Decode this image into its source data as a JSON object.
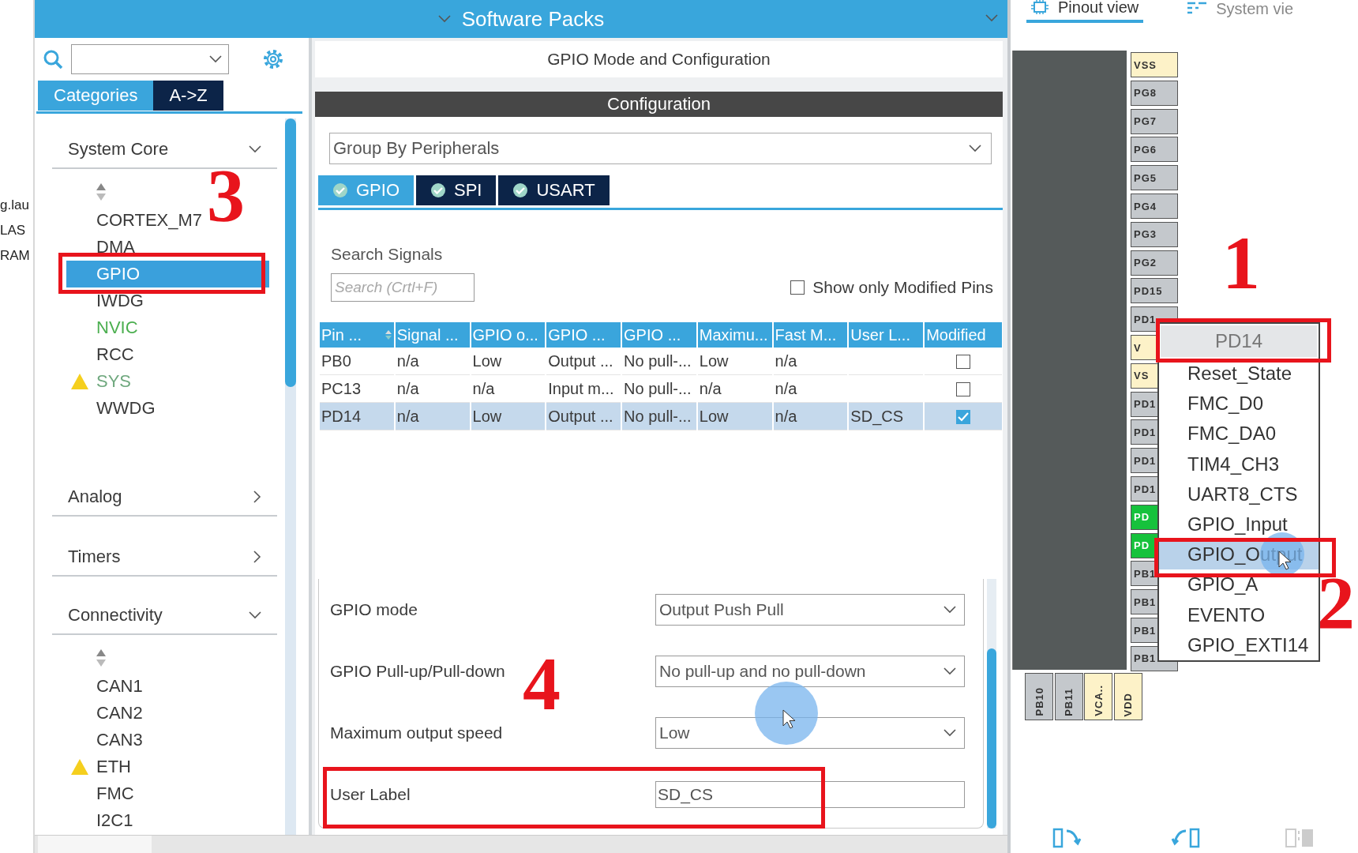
{
  "left_edge": {
    "texts": [
      "g.lau",
      "LAS",
      "RAM"
    ]
  },
  "header": {
    "title": "Software Packs"
  },
  "sidebar": {
    "tabs": [
      {
        "label": "Categories",
        "selected": true
      },
      {
        "label": "A->Z",
        "selected": false
      }
    ],
    "groups": [
      {
        "label": "System Core",
        "expanded": true,
        "items": [
          {
            "label": "CORTEX_M7",
            "selected": false,
            "warning": false,
            "color": "#3a3a3a"
          },
          {
            "label": "DMA",
            "selected": false,
            "warning": false,
            "color": "#3a3a3a"
          },
          {
            "label": "GPIO",
            "selected": true,
            "warning": false,
            "color": "#ffffff"
          },
          {
            "label": "IWDG",
            "selected": false,
            "warning": false,
            "color": "#3a3a3a"
          },
          {
            "label": "NVIC",
            "selected": false,
            "warning": false,
            "color": "#4caf50"
          },
          {
            "label": "RCC",
            "selected": false,
            "warning": false,
            "color": "#3a3a3a"
          },
          {
            "label": "SYS",
            "selected": false,
            "warning": true,
            "color": "#6fa87e"
          },
          {
            "label": "WWDG",
            "selected": false,
            "warning": false,
            "color": "#3a3a3a"
          }
        ]
      },
      {
        "label": "Analog",
        "expanded": false
      },
      {
        "label": "Timers",
        "expanded": false
      },
      {
        "label": "Connectivity",
        "expanded": true,
        "items": [
          {
            "label": "CAN1",
            "selected": false,
            "warning": false,
            "color": "#3a3a3a"
          },
          {
            "label": "CAN2",
            "selected": false,
            "warning": false,
            "color": "#3a3a3a"
          },
          {
            "label": "CAN3",
            "selected": false,
            "warning": false,
            "color": "#3a3a3a"
          },
          {
            "label": "ETH",
            "selected": false,
            "warning": true,
            "color": "#3a3a3a"
          },
          {
            "label": "FMC",
            "selected": false,
            "warning": false,
            "color": "#3a3a3a"
          },
          {
            "label": "I2C1",
            "selected": false,
            "warning": false,
            "color": "#3a3a3a"
          }
        ]
      }
    ]
  },
  "mode_panel": {
    "title": "GPIO Mode and Configuration",
    "section": "Configuration",
    "group_select": "Group By Peripherals",
    "tabs": [
      {
        "label": "GPIO",
        "selected": true
      },
      {
        "label": "SPI",
        "selected": false
      },
      {
        "label": "USART",
        "selected": false
      }
    ],
    "search_label": "Search Signals",
    "search": {
      "placeholder": "Search (Crtl+F)"
    },
    "modified_only": {
      "label": "Show only Modified Pins",
      "checked": false
    },
    "table": {
      "columns": [
        "Pin ...",
        "Signal ...",
        "GPIO o...",
        "GPIO ...",
        "GPIO ...",
        "Maximu...",
        "Fast M...",
        "User L...",
        "Modified"
      ],
      "rows": [
        {
          "cells": [
            "PB0",
            "n/a",
            "Low",
            "Output ...",
            "No pull-...",
            "Low",
            "n/a",
            ""
          ],
          "modified": false,
          "selected": false
        },
        {
          "cells": [
            "PC13",
            "n/a",
            "n/a",
            "Input m...",
            "No pull-...",
            "n/a",
            "n/a",
            ""
          ],
          "modified": false,
          "selected": false
        },
        {
          "cells": [
            "PD14",
            "n/a",
            "Low",
            "Output ...",
            "No pull-...",
            "Low",
            "n/a",
            "SD_CS"
          ],
          "modified": true,
          "selected": true
        }
      ]
    },
    "settings": [
      {
        "label": "GPIO mode",
        "value": "Output Push Pull",
        "kind": "select"
      },
      {
        "label": "GPIO Pull-up/Pull-down",
        "value": "No pull-up and no pull-down",
        "kind": "select"
      },
      {
        "label": "Maximum output speed",
        "value": "Low",
        "kind": "select"
      },
      {
        "label": "User Label",
        "value": "SD_CS",
        "kind": "text"
      }
    ]
  },
  "pinout": {
    "tabs": [
      {
        "label": "Pinout view",
        "selected": true
      },
      {
        "label": "System vie",
        "selected": false
      }
    ],
    "right_pins": [
      {
        "label": "VSS",
        "kind": "power"
      },
      {
        "label": "PG8",
        "kind": "signal"
      },
      {
        "label": "PG7",
        "kind": "signal"
      },
      {
        "label": "PG6",
        "kind": "signal"
      },
      {
        "label": "PG5",
        "kind": "signal"
      },
      {
        "label": "PG4",
        "kind": "signal"
      },
      {
        "label": "PG3",
        "kind": "signal"
      },
      {
        "label": "PG2",
        "kind": "signal"
      },
      {
        "label": "PD15",
        "kind": "signal"
      },
      {
        "label": "PD1",
        "kind": "signal"
      },
      {
        "label": "V",
        "kind": "power"
      },
      {
        "label": "VS",
        "kind": "power"
      },
      {
        "label": "PD1",
        "kind": "signal"
      },
      {
        "label": "PD1",
        "kind": "signal"
      },
      {
        "label": "PD1",
        "kind": "signal"
      },
      {
        "label": "PD1",
        "kind": "signal"
      },
      {
        "label": "PD",
        "kind": "assigned"
      },
      {
        "label": "PD",
        "kind": "assigned"
      },
      {
        "label": "PB1",
        "kind": "signal"
      },
      {
        "label": "PB1",
        "kind": "signal"
      },
      {
        "label": "PB1",
        "kind": "signal"
      },
      {
        "label": "PB1",
        "kind": "signal"
      }
    ],
    "bottom_pins": [
      {
        "label": "PB10",
        "kind": "signal"
      },
      {
        "label": "PB11",
        "kind": "signal"
      },
      {
        "label": "VCA..",
        "kind": "power"
      },
      {
        "label": "VDD",
        "kind": "power"
      }
    ],
    "context_menu": {
      "title": "PD14",
      "items": [
        {
          "label": "Reset_State",
          "selected": false
        },
        {
          "label": "FMC_D0",
          "selected": false
        },
        {
          "label": "FMC_DA0",
          "selected": false
        },
        {
          "label": "TIM4_CH3",
          "selected": false
        },
        {
          "label": "UART8_CTS",
          "selected": false
        },
        {
          "label": "GPIO_Input",
          "selected": false
        },
        {
          "label": "GPIO_Output",
          "selected": true
        },
        {
          "label": "GPIO_A",
          "selected": false
        },
        {
          "label": "EVENTO",
          "selected": false
        },
        {
          "label": "GPIO_EXTI14",
          "selected": false
        }
      ]
    }
  },
  "annotations": [
    {
      "label": "3"
    },
    {
      "label": "1"
    },
    {
      "label": "2"
    },
    {
      "label": "4"
    }
  ]
}
